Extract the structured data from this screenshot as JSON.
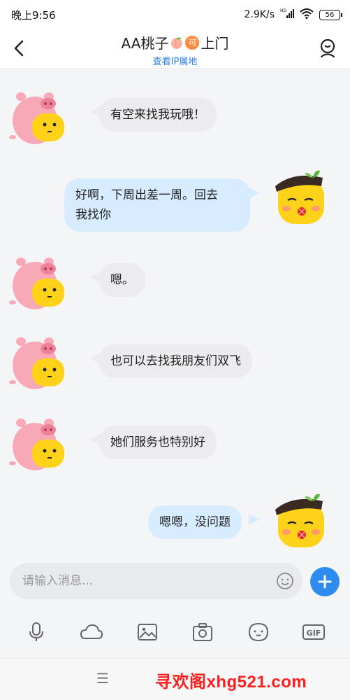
{
  "status_bar": {
    "time": "晚上9:56",
    "network_speed": "2.9K/s",
    "signal_label": "HD",
    "battery": "56"
  },
  "header": {
    "title": "AA桃子",
    "title_badge": "可",
    "title_suffix": "上门",
    "ip_link": "查看IP属地"
  },
  "messages": [
    {
      "side": "left",
      "text": "有空来找我玩哦！"
    },
    {
      "side": "right",
      "text": "好啊，下周出差一周。回去\n我找你"
    },
    {
      "side": "left",
      "text": "嗯。"
    },
    {
      "side": "left",
      "text": "也可以去找我朋友们双飞"
    },
    {
      "side": "left",
      "text": "她们服务也特别好"
    },
    {
      "side": "right",
      "text": "嗯嗯，没问题"
    }
  ],
  "input": {
    "placeholder": "请输入消息..."
  },
  "toolbar": {
    "icons": [
      "microphone-icon",
      "cloud-icon",
      "image-icon",
      "camera-icon",
      "emoji-face-icon",
      "gif-icon"
    ]
  },
  "navbar": {
    "menu_glyph": "☰"
  },
  "watermark": {
    "text": "寻欢阁xhg521.com"
  },
  "colors": {
    "accent": "#2e8cf0",
    "left_bubble": "#ececef",
    "right_bubble": "#d7ecff",
    "watermark": "#ff1f1f",
    "badge": "#ff8a3c"
  }
}
